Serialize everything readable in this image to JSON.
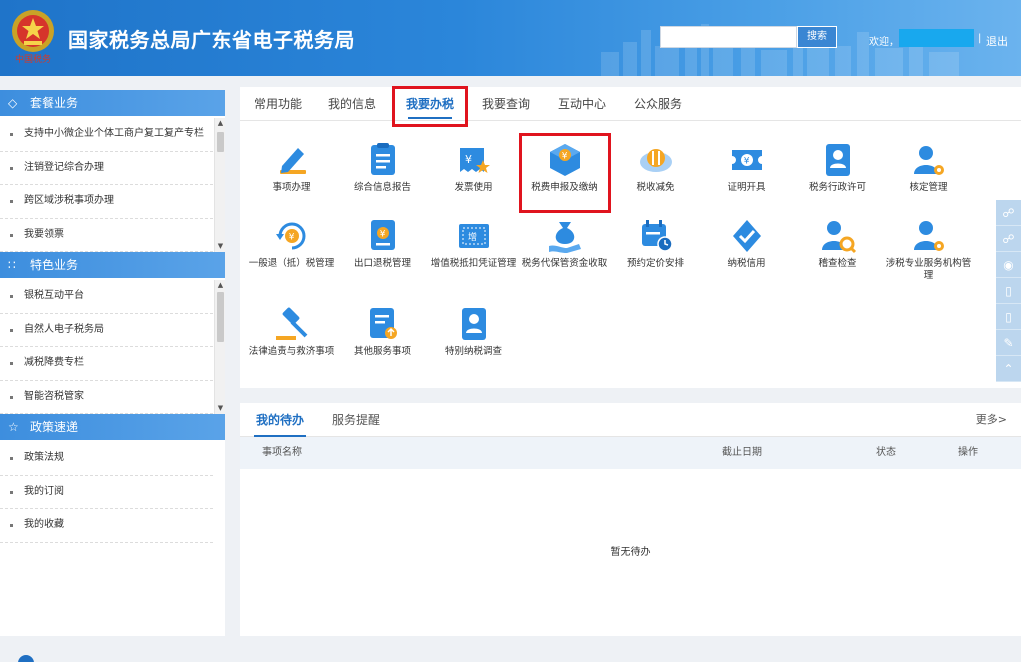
{
  "header": {
    "title": "国家税务总局广东省电子税务局",
    "emblem_text": "中国税务",
    "search_value": "",
    "search_button": "搜索",
    "welcome": "欢迎，",
    "separator": "|",
    "logout": "退出",
    "user_badge_color": "#18a8ee"
  },
  "sidebar": {
    "sections": [
      {
        "title": "套餐业务",
        "icon": "layers-icon",
        "items": [
          "支持中小微企业个体工商户复工复产专栏",
          "注销登记综合办理",
          "跨区域涉税事项办理",
          "我要领票"
        ]
      },
      {
        "title": "特色业务",
        "icon": "grid-icon",
        "items": [
          "银税互动平台",
          "自然人电子税务局",
          "减税降费专栏",
          "智能咨税管家"
        ]
      },
      {
        "title": "政策速递",
        "icon": "star-icon",
        "items": [
          "政策法规",
          "我的订阅",
          "我的收藏"
        ]
      }
    ]
  },
  "tabs": [
    {
      "label": "常用功能",
      "active": false
    },
    {
      "label": "我的信息",
      "active": false
    },
    {
      "label": "我要办税",
      "active": true
    },
    {
      "label": "我要查询",
      "active": false
    },
    {
      "label": "互动中心",
      "active": false
    },
    {
      "label": "公众服务",
      "active": false
    }
  ],
  "functions": [
    {
      "label": "事项办理",
      "icon": "pencil-icon"
    },
    {
      "label": "综合信息报告",
      "icon": "document-icon"
    },
    {
      "label": "发票使用",
      "icon": "invoice-icon"
    },
    {
      "label": "税费申报及缴纳",
      "icon": "tax-box-icon"
    },
    {
      "label": "税收减免",
      "icon": "coins-icon"
    },
    {
      "label": "证明开具",
      "icon": "ticket-icon"
    },
    {
      "label": "税务行政许可",
      "icon": "id-card-icon"
    },
    {
      "label": "核定管理",
      "icon": "user-gear-icon"
    },
    {
      "label": "一般退（抵）税管理",
      "icon": "refund-icon"
    },
    {
      "label": "出口退税管理",
      "icon": "export-icon"
    },
    {
      "label": "增值税抵扣凭证管理",
      "icon": "vat-icon"
    },
    {
      "label": "税务代保管资金收取",
      "icon": "money-bag-icon"
    },
    {
      "label": "预约定价安排",
      "icon": "calendar-clock-icon"
    },
    {
      "label": "纳税信用",
      "icon": "credit-shield-icon"
    },
    {
      "label": "稽查检查",
      "icon": "inspect-icon"
    },
    {
      "label": "涉税专业服务机构管理",
      "icon": "agency-icon"
    },
    {
      "label": "法律追责与救济事项",
      "icon": "gavel-icon"
    },
    {
      "label": "其他服务事项",
      "icon": "other-doc-icon"
    },
    {
      "label": "特别纳税调查",
      "icon": "investigate-icon"
    }
  ],
  "todo": {
    "tabs": [
      {
        "label": "我的待办",
        "active": true
      },
      {
        "label": "服务提醒",
        "active": false
      }
    ],
    "more": "更多>",
    "columns": [
      "事项名称",
      "截止日期",
      "状态",
      "操作"
    ],
    "empty": "暂无待办"
  },
  "floatbar": [
    "chat-icon",
    "chat-icon",
    "weibo-icon",
    "mobile-icon",
    "mobile-icon",
    "edit-icon",
    "up-arrow-icon"
  ],
  "colors": {
    "primary": "#1f6fc2",
    "highlight": "#e0141e",
    "icon_blue": "#2d8be0",
    "accent_orange": "#f5a623"
  }
}
